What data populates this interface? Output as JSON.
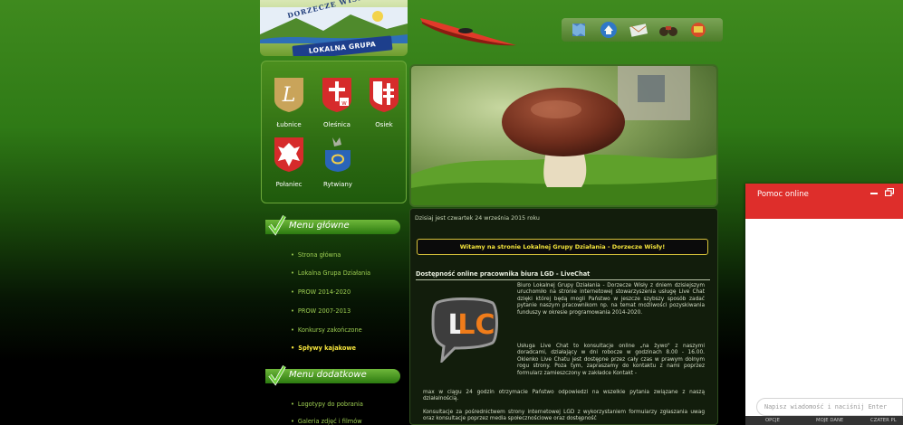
{
  "header": {
    "logo_arc_text": "DORZECZE WISŁY",
    "logo_banner_text": "LOKALNA GRUPA DZIAŁANIA",
    "icons": [
      "map-icon",
      "home-icon",
      "mail-icon",
      "binoculars-icon",
      "flag-icon"
    ]
  },
  "gminy": [
    {
      "name": "Łubnice"
    },
    {
      "name": "Oleśnica"
    },
    {
      "name": "Osiek"
    },
    {
      "name": "Połaniec"
    },
    {
      "name": "Rytwiany"
    }
  ],
  "menu_glowne": {
    "title": "Menu główne",
    "items": [
      "Strona główna",
      "Lokalna Grupa Działania",
      "PROW 2014-2020",
      "PROW 2007-2013",
      "Konkursy zakończone",
      "Spływy kajakowe"
    ],
    "active_index": 5
  },
  "menu_dodatkowe": {
    "title": "Menu dodatkowe",
    "items": [
      "Logotypy do pobrania",
      "Galeria zdjęć i filmów"
    ]
  },
  "main": {
    "today": "Dzisiaj jest czwartek 24 września 2015 roku",
    "welcome": "Witamy na stronie Lokalnej Grupy Działania - Dorzecze Wisły!",
    "article_title": "Dostępność online pracownika biura LGD - LiveChat",
    "logo_letters": "LC",
    "p1": "Biuro Lokalnej Grupy Działania - Dorzecze Wisły z dniem dzisiejszym uruchomiło na stronie internetowej stowarzyszenia usługę Live Chat dzięki której będą mogli Państwo w jeszcze szybszy sposób zadać pytanie naszym pracownikom np. na temat możliwości pozyskiwania funduszy w okresie programowania 2014-2020.",
    "p2": "Usługa Live Chat to konsultacje online „na żywo\" z naszymi doradcami, działający w dni robocze w godzinach 8.00 - 16.00. Okienko Live Chatu jest dostępne przez cały czas w prawym dolnym rogu strony. Poza tym, zapraszamy do kontaktu z nami poprzez formularz zamieszczony w zakładce Kontakt -",
    "p2_cont": "max w ciągu 24 godzin otrzymacie Państwo odpowiedzi na wszelkie pytania związane z naszą działalnością.",
    "p3": "Konsultacje za pośrednictwem strony internetowej LGD z wykorzystaniem formularzy zgłaszania uwag oraz konsultacje poprzez media społecznościowe oraz dostępność"
  },
  "chat": {
    "title": "Pomoc online",
    "placeholder": "Napisz wiadomość i naciśnij Enter",
    "tabs": [
      "OPCJE",
      "MOJE DANE",
      "CZATER PL"
    ],
    "header_color": "#de2e2b"
  }
}
